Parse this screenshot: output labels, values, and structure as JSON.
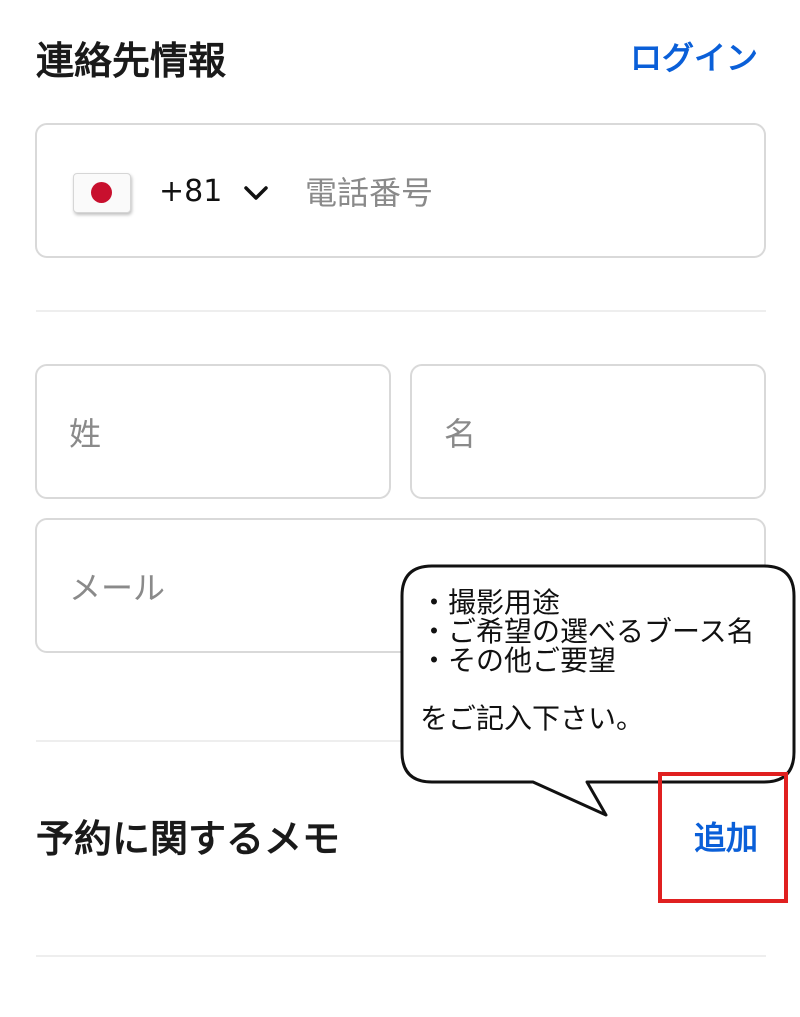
{
  "contact": {
    "title": "連絡先情報",
    "login_label": "ログイン",
    "phone": {
      "country_code": "+81",
      "flag_icon": "japan-flag-icon",
      "placeholder": "電話番号"
    },
    "last_name_placeholder": "姓",
    "first_name_placeholder": "名",
    "email_placeholder": "メール"
  },
  "memo": {
    "title": "予約に関するメモ",
    "add_label": "追加"
  },
  "callout": {
    "lines": [
      "・撮影用途",
      "・ご希望の選べるブース名",
      "・その他ご要望",
      "",
      "をご記入下さい。"
    ]
  },
  "colors": {
    "link": "#0a5fd8",
    "highlight": "#e02020",
    "border": "#d9d9d9",
    "placeholder": "#8a8a8a"
  }
}
